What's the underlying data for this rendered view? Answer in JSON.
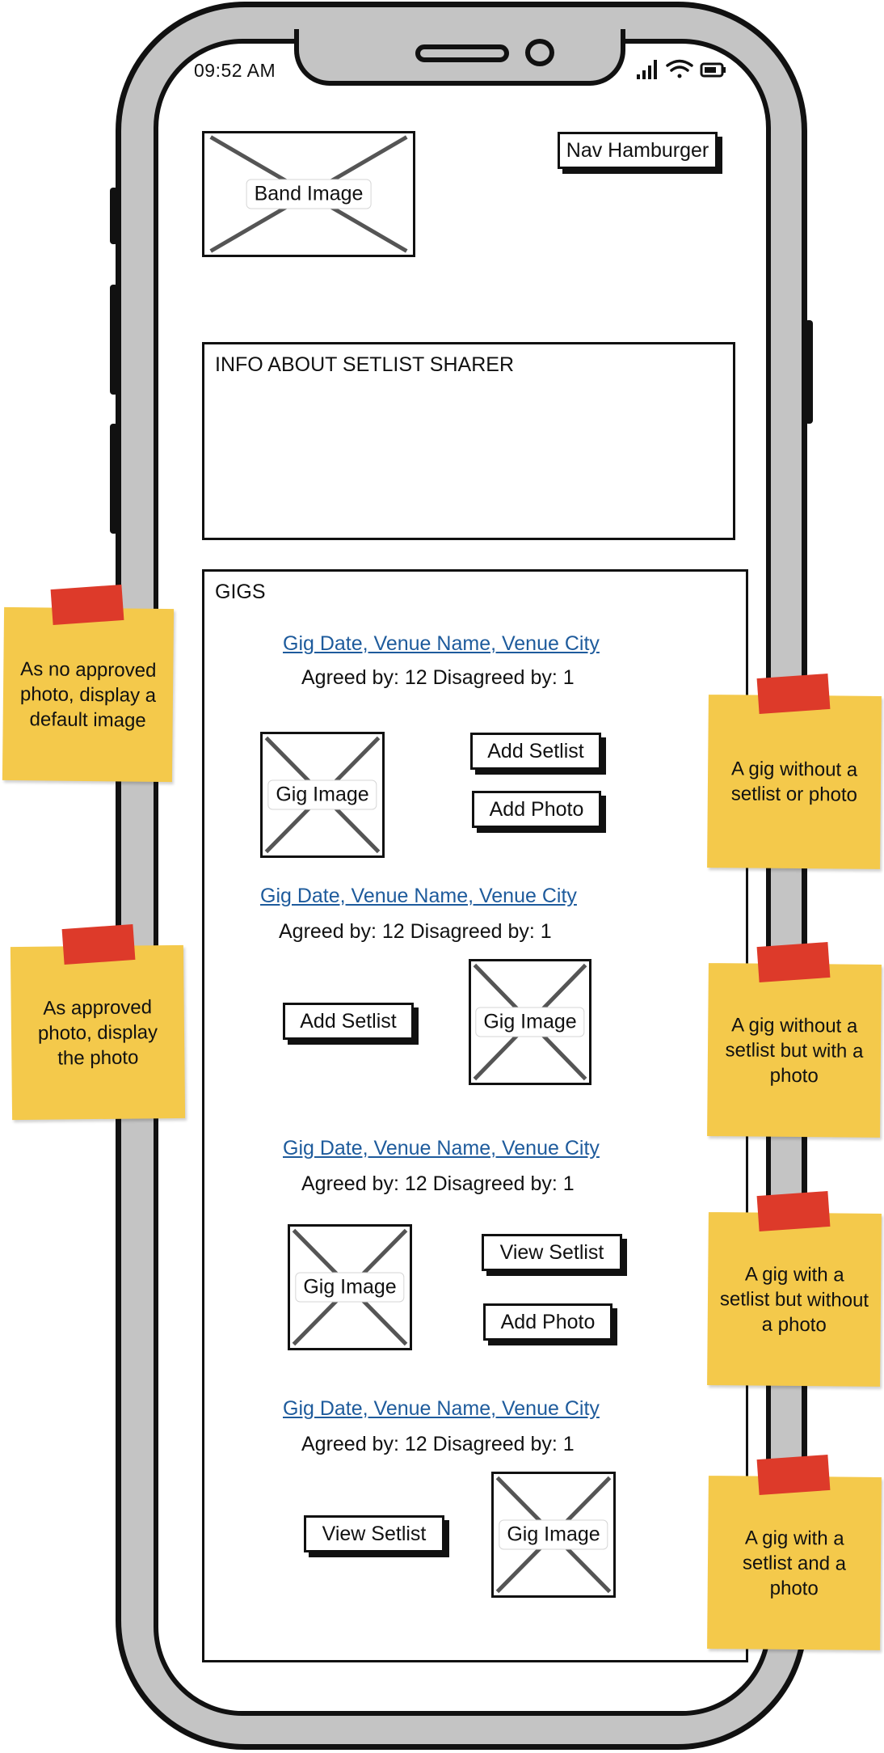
{
  "status_bar": {
    "time": "09:52 AM"
  },
  "header": {
    "band_image_label": "Band Image",
    "nav_label": "Nav Hamburger"
  },
  "info": {
    "title": "INFO ABOUT SETLIST SHARER"
  },
  "gigs": {
    "title": "GIGS",
    "items": [
      {
        "link": "Gig Date, Venue Name, Venue City",
        "votes": "Agreed by: 12 Disagreed by: 1",
        "image_label": "Gig Image",
        "btn1": "Add Setlist",
        "btn2": "Add Photo"
      },
      {
        "link": "Gig Date, Venue Name, Venue City",
        "votes": "Agreed by: 12 Disagreed by: 1",
        "image_label": "Gig Image",
        "btn1": "Add Setlist"
      },
      {
        "link": "Gig Date, Venue Name, Venue City",
        "votes": "Agreed by: 12 Disagreed by: 1",
        "image_label": "Gig Image",
        "btn1": "View Setlist",
        "btn2": "Add Photo"
      },
      {
        "link": "Gig Date, Venue Name, Venue City",
        "votes": "Agreed by: 12 Disagreed by: 1",
        "image_label": "Gig Image",
        "btn1": "View Setlist"
      }
    ]
  },
  "notes": {
    "left_1": "As no approved photo, display a default image",
    "left_2": "As approved photo, display the photo",
    "right_1": "A gig without a setlist or photo",
    "right_2": "A gig without a setlist but with a photo",
    "right_3": "A gig with a setlist but without a photo",
    "right_4": "A gig with a setlist and a photo"
  },
  "colors": {
    "phone_frame": "#c4c4c4",
    "link": "#1e5b9c",
    "sticky_note": "#f4c94b",
    "tape": "#dd3a2a"
  }
}
